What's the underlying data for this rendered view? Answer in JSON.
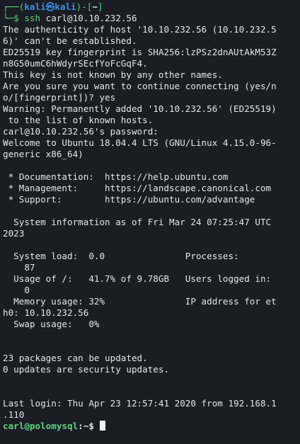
{
  "prompt_top": {
    "corner": "┌──(",
    "user": "kali",
    "skull": "㉿",
    "host": "kali",
    "close": ")-[",
    "path": "~",
    "end": "]"
  },
  "prompt_cmd": {
    "corner": "└─$",
    "command": "ssh",
    "args": " carl@10.10.232.56"
  },
  "lines": [
    "The authenticity of host '10.10.232.56 (10.10.232.5",
    "6)' can't be established.",
    "ED25519 key fingerprint is SHA256:lzPSz2dnAUtAkM53Z",
    "n8G50umC6hWdyrSEcfYoFcGqF4.",
    "This key is not known by any other names.",
    "Are you sure you want to continue connecting (yes/n",
    "o/[fingerprint])? yes",
    "Warning: Permanently added '10.10.232.56' (ED25519)",
    " to the list of known hosts.",
    "carl@10.10.232.56's password:",
    "Welcome to Ubuntu 18.04.4 LTS (GNU/Linux 4.15.0-96-",
    "generic x86_64)",
    "",
    " * Documentation:  https://help.ubuntu.com",
    " * Management:     https://landscape.canonical.com",
    " * Support:        https://ubuntu.com/advantage",
    "",
    "  System information as of Fri Mar 24 07:25:47 UTC",
    "2023",
    "",
    "  System load:  0.0               Processes:",
    "    87",
    "  Usage of /:   41.7% of 9.78GB   Users logged in:",
    "    0",
    "  Memory usage: 32%               IP address for et",
    "h0: 10.10.232.56",
    "  Swap usage:   0%",
    "",
    "",
    "23 packages can be updated.",
    "0 updates are security updates.",
    "",
    "",
    "Last login: Thu Apr 23 12:57:41 2020 from 192.168.1",
    ".110"
  ],
  "final_prompt": {
    "user_host": "carl@polomysql",
    "path_sign": ":~$"
  },
  "colors": {
    "background": "#1a1d24",
    "foreground": "#e4e6ea",
    "prompt_blue": "#3b8ee8",
    "prompt_green": "#5bd17e"
  }
}
